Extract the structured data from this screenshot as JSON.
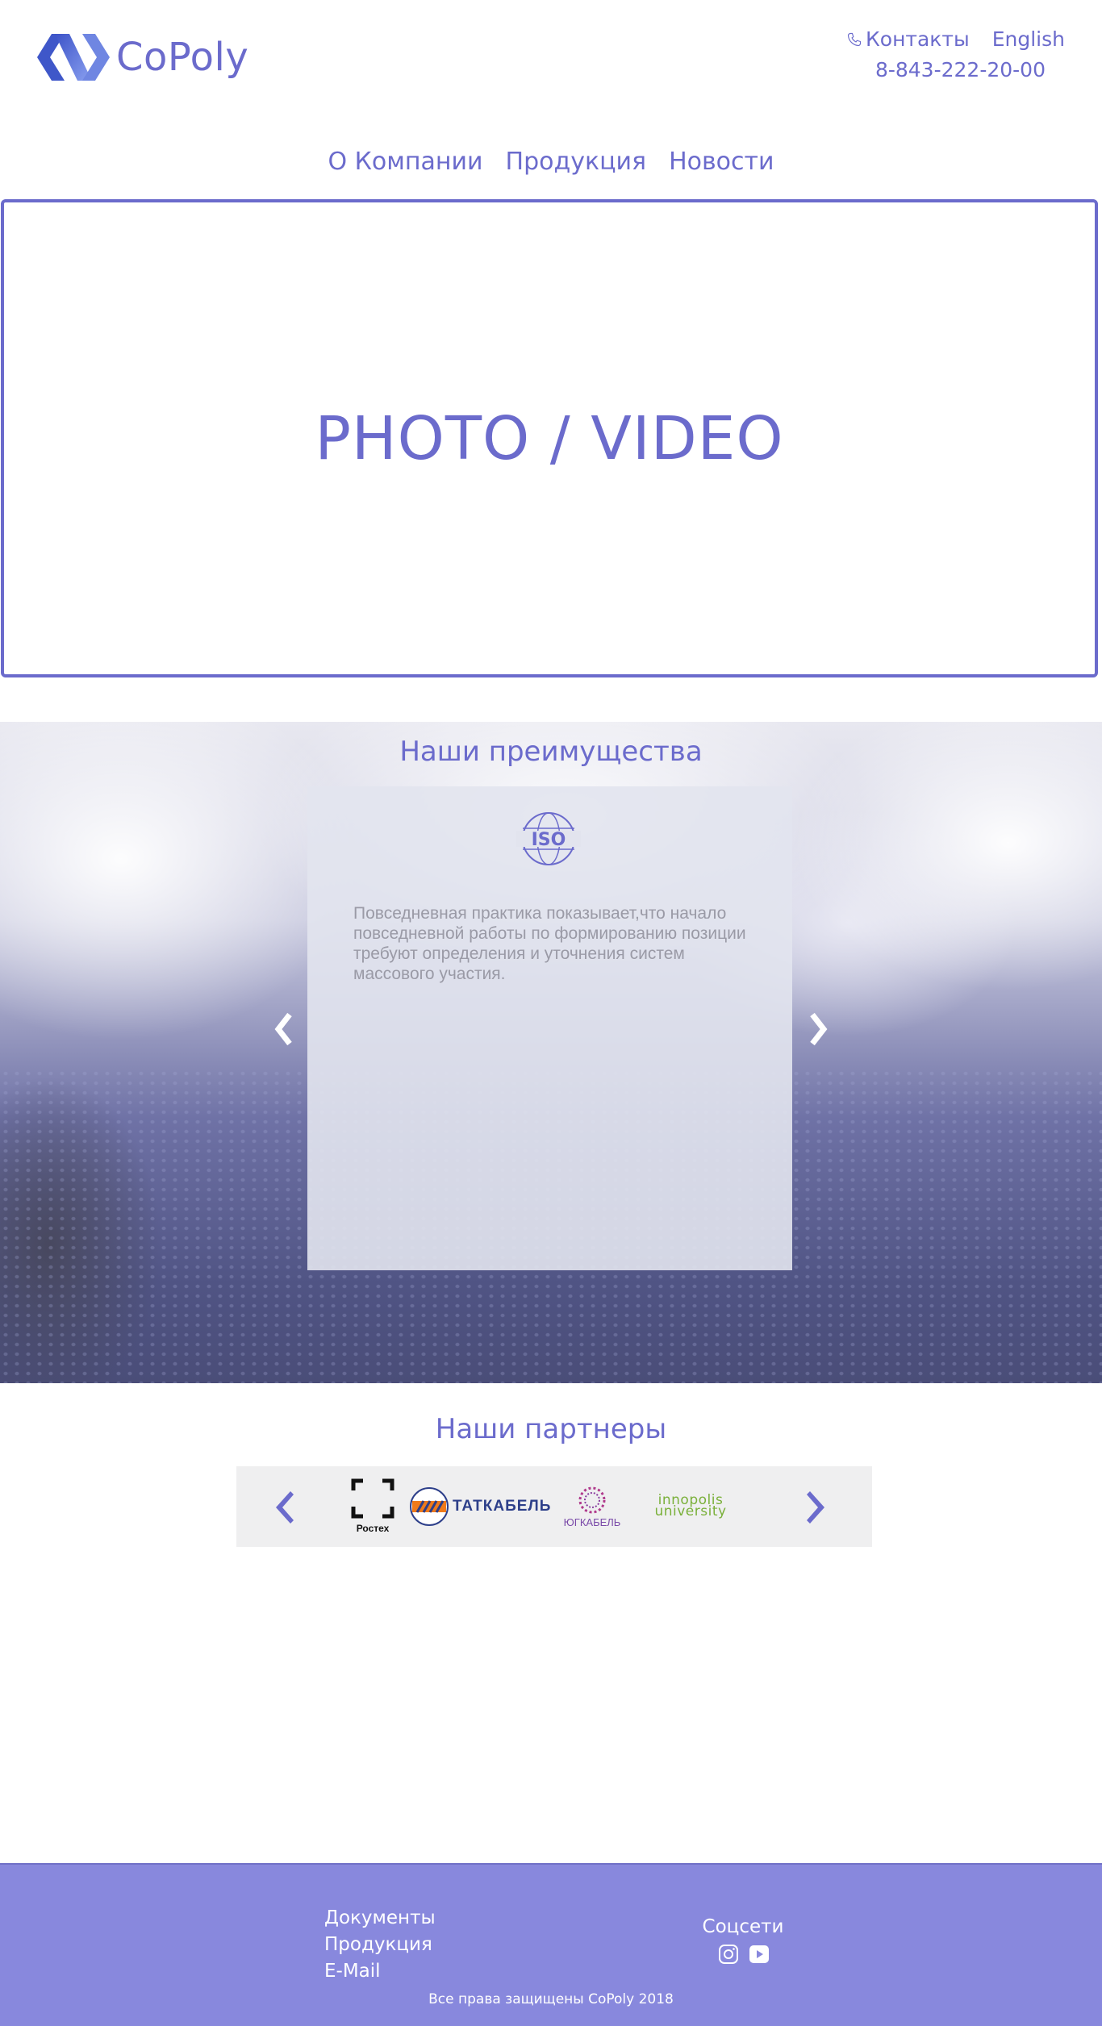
{
  "header": {
    "brand": "CoPoly",
    "contacts_label": "Контакты",
    "language_label": "English",
    "phone": "8-843-222-20-00"
  },
  "nav": {
    "items": [
      {
        "label": "О Компании"
      },
      {
        "label": "Продукция"
      },
      {
        "label": "Новости"
      }
    ]
  },
  "hero": {
    "title": "PHOTO / VIDEO"
  },
  "advantages": {
    "title": "Наши преимущества",
    "badge_text": "ISO",
    "text": "Повседневная практика показывает,что начало повседневной работы по формированию позиции требуют определения и уточнения систем массового  участия."
  },
  "partners": {
    "title": "Наши партнеры",
    "logos": [
      {
        "label": "Ростех"
      },
      {
        "label": "ТАТКАБЕЛЬ"
      },
      {
        "label": "ЮГКАБЕЛЬ"
      },
      {
        "label": "innopolis university"
      }
    ]
  },
  "footer": {
    "links": [
      {
        "label": "Документы"
      },
      {
        "label": "Продукция"
      },
      {
        "label": "E-Mail"
      }
    ],
    "social_title": "Соцсети",
    "copyright": "Все права защищены CoPoly 2018"
  },
  "colors": {
    "accent": "#6b6bcc",
    "footer_bg": "#8888dd",
    "card_bg": "#e2e4ee",
    "partner_bar_bg": "#efeff0"
  },
  "icons": {
    "phone": "phone-icon",
    "instagram": "instagram-icon",
    "youtube": "youtube-icon",
    "prev": "chevron-left-icon",
    "next": "chevron-right-icon"
  }
}
